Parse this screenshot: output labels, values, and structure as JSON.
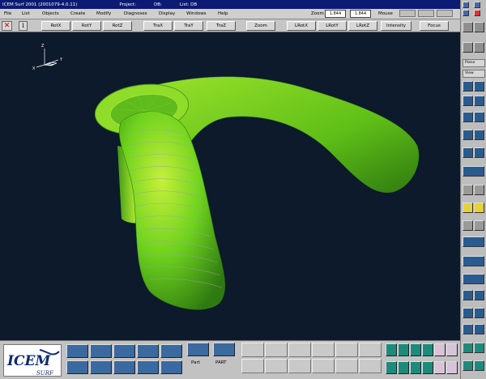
{
  "window": {
    "title": "ICEM Surf 2001 (2001079-4.0.11)",
    "project_label": "Project:",
    "db_label": "DB:",
    "list_label": "List: DB"
  },
  "menu": [
    "File",
    "List",
    "Objects",
    "Create",
    "Modify",
    "Diagnoses",
    "Display",
    "Windows",
    "Help"
  ],
  "zoom": {
    "label": "Zoom",
    "value1": "1.844",
    "value2": "1.844"
  },
  "mouse": {
    "label": "Mouse"
  },
  "toolbar": {
    "buttons": [
      "RotX",
      "RotY",
      "RotZ",
      "TraX",
      "TraY",
      "TraZ",
      "Zoom",
      "LRotX",
      "LRotY",
      "LRotZ",
      "Intensity",
      "Focus"
    ]
  },
  "axes": {
    "z": "Z",
    "x": "X",
    "y": "Y"
  },
  "right_panel": {
    "plane": "Plane",
    "view": "View"
  },
  "bottom": {
    "logo_top": "ICEM",
    "logo_bottom": "SURF",
    "part_label": "Part",
    "part_caps_label": "PART"
  },
  "colors": {
    "viewport_bg": "#0c1a2b",
    "surface": "#6ed21e",
    "title_bg": "#0b1b73"
  }
}
